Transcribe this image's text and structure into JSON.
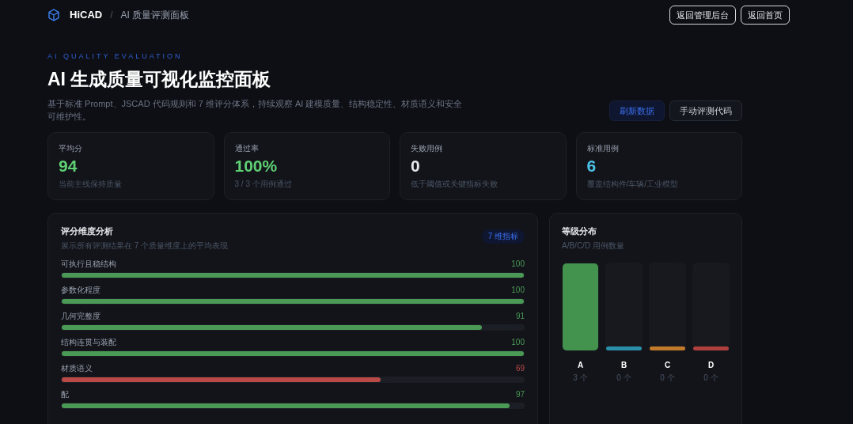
{
  "header": {
    "brand": "HiCAD",
    "separator": "/",
    "breadcrumb": "AI 质量评测面板",
    "buttons": [
      "返回管理后台",
      "返回首页"
    ]
  },
  "hero": {
    "eyebrow": "AI QUALITY EVALUATION",
    "title": "AI 生成质量可视化监控面板",
    "description": "基于标准 Prompt、JSCAD 代码规则和 7 维评分体系，持续观察 AI 建模质量、结构稳定性、材质语义和安全可维护性。",
    "actions": [
      {
        "label": "刷新数据",
        "kind": "primary"
      },
      {
        "label": "手动评测代码",
        "kind": "secondary"
      }
    ]
  },
  "stats": [
    {
      "label": "平均分",
      "value": "94",
      "note": "当前主线保持质量",
      "color": "#5fcf73"
    },
    {
      "label": "通过率",
      "value": "100%",
      "note": "3 / 3 个用例通过",
      "color": "#5fcf73"
    },
    {
      "label": "失败用例",
      "value": "0",
      "note": "低于阈值或关键指标失败",
      "color": "#e5e7eb"
    },
    {
      "label": "标准用例",
      "value": "6",
      "note": "覆盖结构件/车辆/工业模型",
      "color": "#4cc3e6"
    }
  ],
  "dimensions": {
    "title": "评分维度分析",
    "subtitle": "展示所有评测结果在 7 个质量维度上的平均表现",
    "badge": "7 维指标",
    "items": [
      {
        "label": "可执行且稳结构",
        "score": "100",
        "level": 1,
        "color": "#4a9a55"
      },
      {
        "label": "参数化程度",
        "score": "100",
        "level": 1,
        "color": "#4a9a55"
      },
      {
        "label": "几何完整度",
        "score": "91",
        "level": 0.91,
        "color": "#4a9a55"
      },
      {
        "label": "结构连贯与装配",
        "score": "100",
        "level": 1,
        "color": "#4a9a55"
      },
      {
        "label": "材质语义",
        "score": "69",
        "level": 0.69,
        "color": "#b94a48"
      },
      {
        "label": "配",
        "score": "97",
        "level": 0.97,
        "color": "#4a9a55"
      }
    ]
  },
  "grades": {
    "title": "等级分布",
    "subtitle": "A/B/C/D 用例数量",
    "items": [
      {
        "grade": "A",
        "count": "3 个",
        "level": 1,
        "color": "#43924e"
      },
      {
        "grade": "B",
        "count": "0 个",
        "level": 0,
        "color": "#2a8fa8"
      },
      {
        "grade": "C",
        "count": "0 个",
        "level": 0,
        "color": "#c07a2a"
      },
      {
        "grade": "D",
        "count": "0 个",
        "level": 0,
        "color": "#b0403e"
      }
    ]
  }
}
